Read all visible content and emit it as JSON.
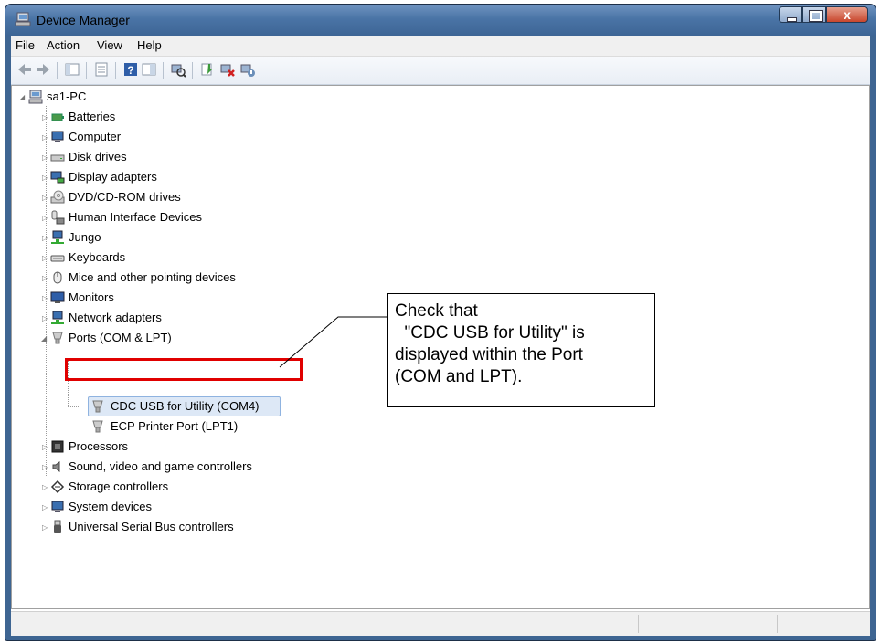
{
  "window": {
    "title": "Device Manager",
    "caption_buttons": [
      "minimize",
      "maximize",
      "close"
    ],
    "close_glyph": "x"
  },
  "menu": [
    "File",
    "Action",
    "View",
    "Help"
  ],
  "toolbar_icons": [
    "back-arrow-icon",
    "forward-arrow-icon",
    "show-hide-console-tree-icon",
    "properties-icon",
    "help-icon",
    "action-pane-icon",
    "scan-hardware-icon",
    "update-driver-icon",
    "uninstall-icon",
    "disable-device-icon"
  ],
  "tree": {
    "root": "sa1-PC",
    "categories": [
      {
        "label": "Batteries",
        "icon": "battery-icon"
      },
      {
        "label": "Computer",
        "icon": "computer-icon"
      },
      {
        "label": "Disk drives",
        "icon": "disk-drive-icon"
      },
      {
        "label": "Display adapters",
        "icon": "display-adapter-icon"
      },
      {
        "label": "DVD/CD-ROM drives",
        "icon": "dvd-drive-icon"
      },
      {
        "label": "Human Interface Devices",
        "icon": "hid-icon"
      },
      {
        "label": "Jungo",
        "icon": "network-icon"
      },
      {
        "label": "Keyboards",
        "icon": "keyboard-icon"
      },
      {
        "label": "Mice and other pointing devices",
        "icon": "mouse-icon"
      },
      {
        "label": "Monitors",
        "icon": "monitor-icon"
      },
      {
        "label": "Network adapters",
        "icon": "network-icon"
      },
      {
        "label": "Ports (COM & LPT)",
        "icon": "port-icon",
        "expanded": true,
        "children": [
          "CDC USB for Utility (COM4)",
          "ECP Printer Port (LPT1)"
        ]
      },
      {
        "label": "Processors",
        "icon": "processor-icon"
      },
      {
        "label": "Sound, video and game controllers",
        "icon": "speaker-icon"
      },
      {
        "label": "Storage controllers",
        "icon": "storage-icon"
      },
      {
        "label": "System devices",
        "icon": "computer-icon"
      },
      {
        "label": "Universal Serial Bus controllers",
        "icon": "usb-icon"
      }
    ]
  },
  "annotation": {
    "callout_text": "Check that\n  \"CDC USB for Utility\" is\ndisplayed within the Port\n(COM and LPT).",
    "highlight_color": "#e00000"
  },
  "colors": {
    "titlebar": "#4a74a6",
    "selection": "#dde8f6"
  }
}
